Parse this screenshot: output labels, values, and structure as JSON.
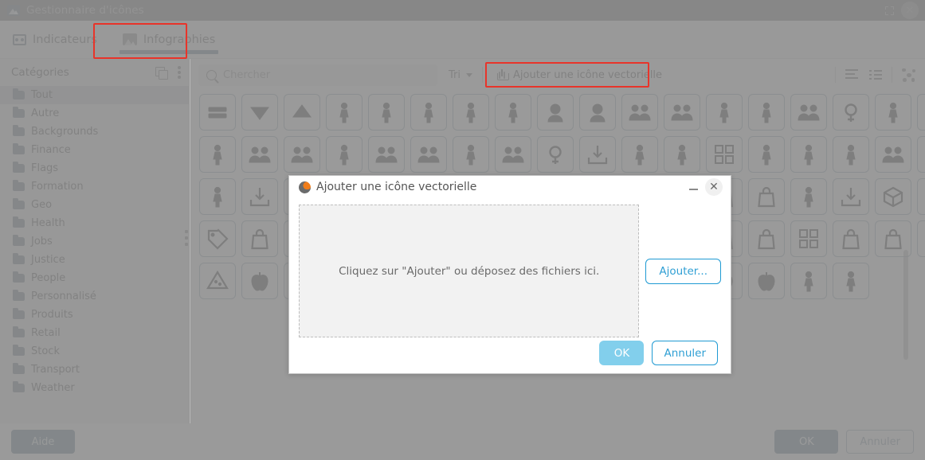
{
  "window": {
    "title": "Gestionnaire d'icônes",
    "icon": "image-icon",
    "maximize_icon": "maximize-icon",
    "close_icon": "close-icon"
  },
  "tabs": [
    {
      "label": "Indicateurs",
      "icon": "indicator-icon",
      "active": false
    },
    {
      "label": "Infographies",
      "icon": "infographic-icon",
      "active": true
    }
  ],
  "sidebar": {
    "header": "Catégories",
    "add_collection_icon": "add-collection-icon",
    "more_icon": "more-vertical-icon",
    "items": [
      {
        "label": "Tout",
        "selected": true
      },
      {
        "label": "Autre",
        "selected": false
      },
      {
        "label": "Backgrounds",
        "selected": false
      },
      {
        "label": "Finance",
        "selected": false
      },
      {
        "label": "Flags",
        "selected": false
      },
      {
        "label": "Formation",
        "selected": false
      },
      {
        "label": "Geo",
        "selected": false
      },
      {
        "label": "Health",
        "selected": false
      },
      {
        "label": "Jobs",
        "selected": false
      },
      {
        "label": "Justice",
        "selected": false
      },
      {
        "label": "People",
        "selected": false
      },
      {
        "label": "Personnalisé",
        "selected": false
      },
      {
        "label": "Produits",
        "selected": false
      },
      {
        "label": "Retail",
        "selected": false
      },
      {
        "label": "Stock",
        "selected": false
      },
      {
        "label": "Transport",
        "selected": false
      },
      {
        "label": "Weather",
        "selected": false
      }
    ]
  },
  "toolbar": {
    "search_placeholder": "Chercher",
    "search_value": "",
    "search_icon": "search-icon",
    "sort_label": "Tri",
    "sort_caret_icon": "chevron-down-icon",
    "add_vector_label": "Ajouter une icône vectorielle",
    "add_vector_icon": "upload-icon",
    "sort_list_icon": "sort-list-icon",
    "list_view_icon": "list-view-icon",
    "node_graph_icon": "node-graph-icon"
  },
  "grid": {
    "cell_border_color": "#8fb6cc",
    "icon_color": "#5e5e5e",
    "rows": 8,
    "columns": 16,
    "icons": [
      "equals-bars",
      "triangle-down",
      "triangle-up",
      "person-add-outline",
      "person-add-filled",
      "person-waving",
      "person-standing",
      "person-running",
      "smiley-face",
      "face-bald",
      "family-group",
      "two-people",
      "person-stand-wide",
      "person-sliding",
      "family-four",
      "female-symbol",
      "child-standing",
      "elderly-cane",
      "person-hand-hip",
      "elderly-woman-cane",
      "woman-dress",
      "group-three-outline",
      "group-three-filled",
      "person-profile",
      "people-two-filled",
      "group-crowd",
      "adult-child",
      "family-four-b",
      "male-symbol",
      "person-pushing-cart",
      "parent-child",
      "person-arms-up",
      "person-height-chart",
      "person-tree-bench",
      "person-large",
      "person-exercise",
      "people-small-group",
      "person-hand-up",
      "person-avatar",
      "person-side",
      "person-hiking",
      "person-cart",
      "person-walking-case",
      "package-tag",
      "person-portrait",
      "person-bust",
      "person-luggage",
      "person-travel",
      "box-open",
      "box-closed",
      "box-arrow-down",
      "price-tag",
      "shopping-bag-percent",
      "shopping-bag-percent-outline",
      "gear-heavy",
      "clipboard-cart",
      "inbox-download",
      "cube-3d",
      "warehouse",
      "delivery",
      "barcode",
      "basket",
      "shelf-unit",
      "grid-squares",
      "book-open",
      "eraser",
      "bag-handle",
      "wallet",
      "card",
      "tag-round",
      "label",
      "briefcase",
      "suitcase",
      "lock-bag",
      "calculator",
      "register",
      "bag-basic",
      "shop-front",
      "storefront",
      "basket-full",
      "burger-drink",
      "peanut",
      "apple-filled",
      "apple-outline",
      "carrot-filled",
      "carrot-outline",
      "fish-filled",
      "fish-outline",
      "pizza-filled",
      "pizza-outline",
      "meat-cut",
      "drumstick",
      "bread",
      "cheese",
      "bottle",
      "cup"
    ]
  },
  "bottombar": {
    "help_label": "Aide",
    "ok_label": "OK",
    "cancel_label": "Annuler"
  },
  "modal": {
    "title": "Ajouter une icône vectorielle",
    "title_icon": "app-ball-icon",
    "minimize_icon": "minimize-icon",
    "close_icon": "close-icon",
    "dropzone_text": "Cliquez sur \"Ajouter\" ou déposez des fichiers ici.",
    "add_label": "Ajouter...",
    "ok_label": "OK",
    "cancel_label": "Annuler"
  },
  "annotations": {
    "tab_highlight": "Infographies",
    "toolbar_highlight": "Ajouter une icône vectorielle",
    "highlight_color": "#e8342a"
  }
}
